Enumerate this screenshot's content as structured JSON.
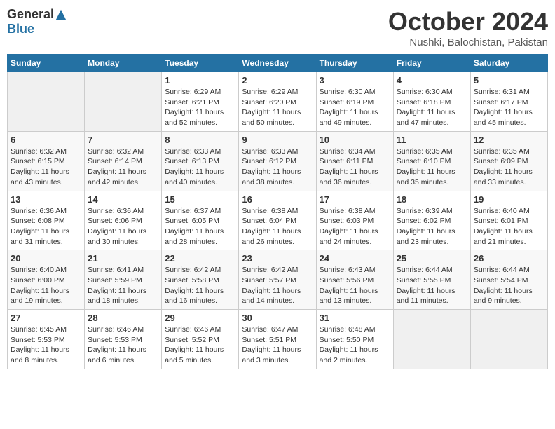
{
  "header": {
    "logo_general": "General",
    "logo_blue": "Blue",
    "month_title": "October 2024",
    "location": "Nushki, Balochistan, Pakistan"
  },
  "calendar": {
    "days_of_week": [
      "Sunday",
      "Monday",
      "Tuesday",
      "Wednesday",
      "Thursday",
      "Friday",
      "Saturday"
    ],
    "weeks": [
      [
        {
          "day": "",
          "info": ""
        },
        {
          "day": "",
          "info": ""
        },
        {
          "day": "1",
          "sunrise": "Sunrise: 6:29 AM",
          "sunset": "Sunset: 6:21 PM",
          "daylight": "Daylight: 11 hours and 52 minutes."
        },
        {
          "day": "2",
          "sunrise": "Sunrise: 6:29 AM",
          "sunset": "Sunset: 6:20 PM",
          "daylight": "Daylight: 11 hours and 50 minutes."
        },
        {
          "day": "3",
          "sunrise": "Sunrise: 6:30 AM",
          "sunset": "Sunset: 6:19 PM",
          "daylight": "Daylight: 11 hours and 49 minutes."
        },
        {
          "day": "4",
          "sunrise": "Sunrise: 6:30 AM",
          "sunset": "Sunset: 6:18 PM",
          "daylight": "Daylight: 11 hours and 47 minutes."
        },
        {
          "day": "5",
          "sunrise": "Sunrise: 6:31 AM",
          "sunset": "Sunset: 6:17 PM",
          "daylight": "Daylight: 11 hours and 45 minutes."
        }
      ],
      [
        {
          "day": "6",
          "sunrise": "Sunrise: 6:32 AM",
          "sunset": "Sunset: 6:15 PM",
          "daylight": "Daylight: 11 hours and 43 minutes."
        },
        {
          "day": "7",
          "sunrise": "Sunrise: 6:32 AM",
          "sunset": "Sunset: 6:14 PM",
          "daylight": "Daylight: 11 hours and 42 minutes."
        },
        {
          "day": "8",
          "sunrise": "Sunrise: 6:33 AM",
          "sunset": "Sunset: 6:13 PM",
          "daylight": "Daylight: 11 hours and 40 minutes."
        },
        {
          "day": "9",
          "sunrise": "Sunrise: 6:33 AM",
          "sunset": "Sunset: 6:12 PM",
          "daylight": "Daylight: 11 hours and 38 minutes."
        },
        {
          "day": "10",
          "sunrise": "Sunrise: 6:34 AM",
          "sunset": "Sunset: 6:11 PM",
          "daylight": "Daylight: 11 hours and 36 minutes."
        },
        {
          "day": "11",
          "sunrise": "Sunrise: 6:35 AM",
          "sunset": "Sunset: 6:10 PM",
          "daylight": "Daylight: 11 hours and 35 minutes."
        },
        {
          "day": "12",
          "sunrise": "Sunrise: 6:35 AM",
          "sunset": "Sunset: 6:09 PM",
          "daylight": "Daylight: 11 hours and 33 minutes."
        }
      ],
      [
        {
          "day": "13",
          "sunrise": "Sunrise: 6:36 AM",
          "sunset": "Sunset: 6:08 PM",
          "daylight": "Daylight: 11 hours and 31 minutes."
        },
        {
          "day": "14",
          "sunrise": "Sunrise: 6:36 AM",
          "sunset": "Sunset: 6:06 PM",
          "daylight": "Daylight: 11 hours and 30 minutes."
        },
        {
          "day": "15",
          "sunrise": "Sunrise: 6:37 AM",
          "sunset": "Sunset: 6:05 PM",
          "daylight": "Daylight: 11 hours and 28 minutes."
        },
        {
          "day": "16",
          "sunrise": "Sunrise: 6:38 AM",
          "sunset": "Sunset: 6:04 PM",
          "daylight": "Daylight: 11 hours and 26 minutes."
        },
        {
          "day": "17",
          "sunrise": "Sunrise: 6:38 AM",
          "sunset": "Sunset: 6:03 PM",
          "daylight": "Daylight: 11 hours and 24 minutes."
        },
        {
          "day": "18",
          "sunrise": "Sunrise: 6:39 AM",
          "sunset": "Sunset: 6:02 PM",
          "daylight": "Daylight: 11 hours and 23 minutes."
        },
        {
          "day": "19",
          "sunrise": "Sunrise: 6:40 AM",
          "sunset": "Sunset: 6:01 PM",
          "daylight": "Daylight: 11 hours and 21 minutes."
        }
      ],
      [
        {
          "day": "20",
          "sunrise": "Sunrise: 6:40 AM",
          "sunset": "Sunset: 6:00 PM",
          "daylight": "Daylight: 11 hours and 19 minutes."
        },
        {
          "day": "21",
          "sunrise": "Sunrise: 6:41 AM",
          "sunset": "Sunset: 5:59 PM",
          "daylight": "Daylight: 11 hours and 18 minutes."
        },
        {
          "day": "22",
          "sunrise": "Sunrise: 6:42 AM",
          "sunset": "Sunset: 5:58 PM",
          "daylight": "Daylight: 11 hours and 16 minutes."
        },
        {
          "day": "23",
          "sunrise": "Sunrise: 6:42 AM",
          "sunset": "Sunset: 5:57 PM",
          "daylight": "Daylight: 11 hours and 14 minutes."
        },
        {
          "day": "24",
          "sunrise": "Sunrise: 6:43 AM",
          "sunset": "Sunset: 5:56 PM",
          "daylight": "Daylight: 11 hours and 13 minutes."
        },
        {
          "day": "25",
          "sunrise": "Sunrise: 6:44 AM",
          "sunset": "Sunset: 5:55 PM",
          "daylight": "Daylight: 11 hours and 11 minutes."
        },
        {
          "day": "26",
          "sunrise": "Sunrise: 6:44 AM",
          "sunset": "Sunset: 5:54 PM",
          "daylight": "Daylight: 11 hours and 9 minutes."
        }
      ],
      [
        {
          "day": "27",
          "sunrise": "Sunrise: 6:45 AM",
          "sunset": "Sunset: 5:53 PM",
          "daylight": "Daylight: 11 hours and 8 minutes."
        },
        {
          "day": "28",
          "sunrise": "Sunrise: 6:46 AM",
          "sunset": "Sunset: 5:53 PM",
          "daylight": "Daylight: 11 hours and 6 minutes."
        },
        {
          "day": "29",
          "sunrise": "Sunrise: 6:46 AM",
          "sunset": "Sunset: 5:52 PM",
          "daylight": "Daylight: 11 hours and 5 minutes."
        },
        {
          "day": "30",
          "sunrise": "Sunrise: 6:47 AM",
          "sunset": "Sunset: 5:51 PM",
          "daylight": "Daylight: 11 hours and 3 minutes."
        },
        {
          "day": "31",
          "sunrise": "Sunrise: 6:48 AM",
          "sunset": "Sunset: 5:50 PM",
          "daylight": "Daylight: 11 hours and 2 minutes."
        },
        {
          "day": "",
          "info": ""
        },
        {
          "day": "",
          "info": ""
        }
      ]
    ]
  }
}
